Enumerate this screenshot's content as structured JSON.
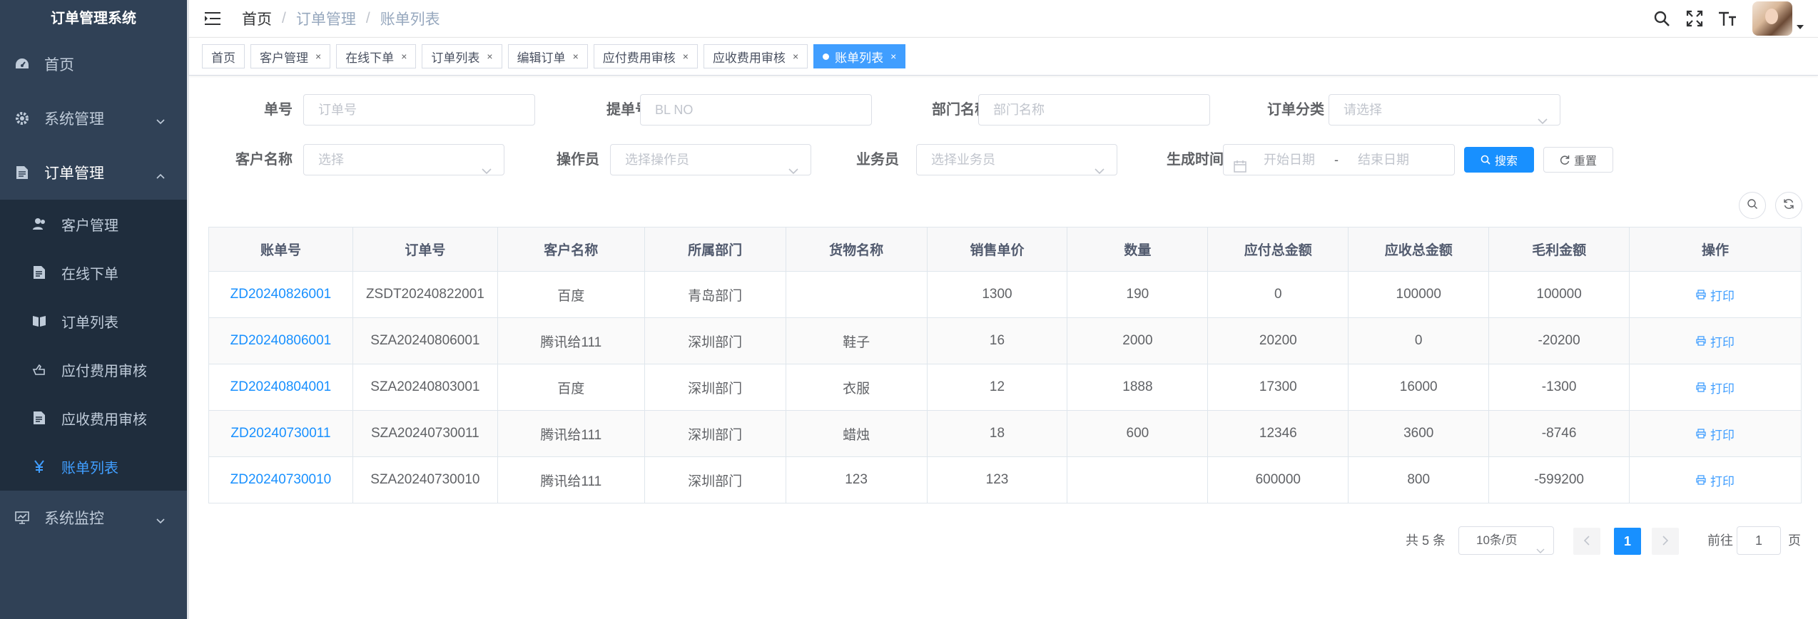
{
  "sidebar": {
    "title": "订单管理系统",
    "menu": [
      {
        "label": "首页",
        "icon": "dashboard-icon"
      },
      {
        "label": "系统管理",
        "icon": "gear-icon"
      },
      {
        "label": "订单管理",
        "icon": "document-icon"
      }
    ],
    "submenu": [
      {
        "label": "客户管理",
        "icon": "user-icon"
      },
      {
        "label": "在线下单",
        "icon": "edit-doc-icon"
      },
      {
        "label": "订单列表",
        "icon": "book-icon"
      },
      {
        "label": "应付费用审核",
        "icon": "pay-icon"
      },
      {
        "label": "应收费用审核",
        "icon": "receipt-icon"
      },
      {
        "label": "账单列表",
        "icon": "yen-icon"
      }
    ],
    "monitor": {
      "label": "系统监控",
      "icon": "monitor-icon"
    }
  },
  "breadcrumb": {
    "home": "首页",
    "mid": "订单管理",
    "current": "账单列表",
    "sep": "/"
  },
  "tags": [
    {
      "label": "首页"
    },
    {
      "label": "客户管理"
    },
    {
      "label": "在线下单"
    },
    {
      "label": "订单列表"
    },
    {
      "label": "编辑订单"
    },
    {
      "label": "应付费用审核"
    },
    {
      "label": "应收费用审核"
    },
    {
      "label": "账单列表"
    }
  ],
  "tag_close": "×",
  "filters": {
    "order_no": {
      "label": "单号",
      "placeholder": "订单号"
    },
    "bl_no": {
      "label": "提单号",
      "placeholder": "BL NO"
    },
    "dept": {
      "label": "部门名称",
      "placeholder": "部门名称"
    },
    "category": {
      "label": "订单分类",
      "placeholder": "请选择"
    },
    "customer": {
      "label": "客户名称",
      "placeholder": "选择"
    },
    "operator": {
      "label": "操作员",
      "placeholder": "选择操作员"
    },
    "salesman": {
      "label": "业务员",
      "placeholder": "选择业务员"
    },
    "created": {
      "label": "生成时间",
      "start": "开始日期",
      "sep": "-",
      "end": "结束日期"
    },
    "search_label": "搜索",
    "reset_label": "重置"
  },
  "table": {
    "headers": [
      "账单号",
      "订单号",
      "客户名称",
      "所属部门",
      "货物名称",
      "销售单价",
      "数量",
      "应付总金额",
      "应收总金额",
      "毛利金额",
      "操作"
    ],
    "print_label": "打印",
    "rows": [
      [
        "ZD20240826001",
        "ZSDT20240822001",
        "百度",
        "青岛部门",
        "",
        "1300",
        "190",
        "0",
        "100000",
        "100000"
      ],
      [
        "ZD20240806001",
        "SZA20240806001",
        "腾讯给111",
        "深圳部门",
        "鞋子",
        "16",
        "2000",
        "20200",
        "0",
        "-20200"
      ],
      [
        "ZD20240804001",
        "SZA20240803001",
        "百度",
        "深圳部门",
        "衣服",
        "12",
        "1888",
        "17300",
        "16000",
        "-1300"
      ],
      [
        "ZD20240730011",
        "SZA20240730011",
        "腾讯给111",
        "深圳部门",
        "蜡烛",
        "18",
        "600",
        "12346",
        "3600",
        "-8746"
      ],
      [
        "ZD20240730010",
        "SZA20240730010",
        "腾讯给111",
        "深圳部门",
        "123",
        "123",
        "",
        "600000",
        "800",
        "-599200"
      ]
    ]
  },
  "pagination": {
    "total": "共 5 条",
    "page_size": "10条/页",
    "current": "1",
    "goto_label": "前往",
    "goto_value": "1",
    "page_suffix": "页"
  },
  "colors": {
    "sidebar_bg": "#304156",
    "submenu_bg": "#1f2d3d",
    "primary": "#1890ff",
    "active_menu": "#409eff"
  }
}
